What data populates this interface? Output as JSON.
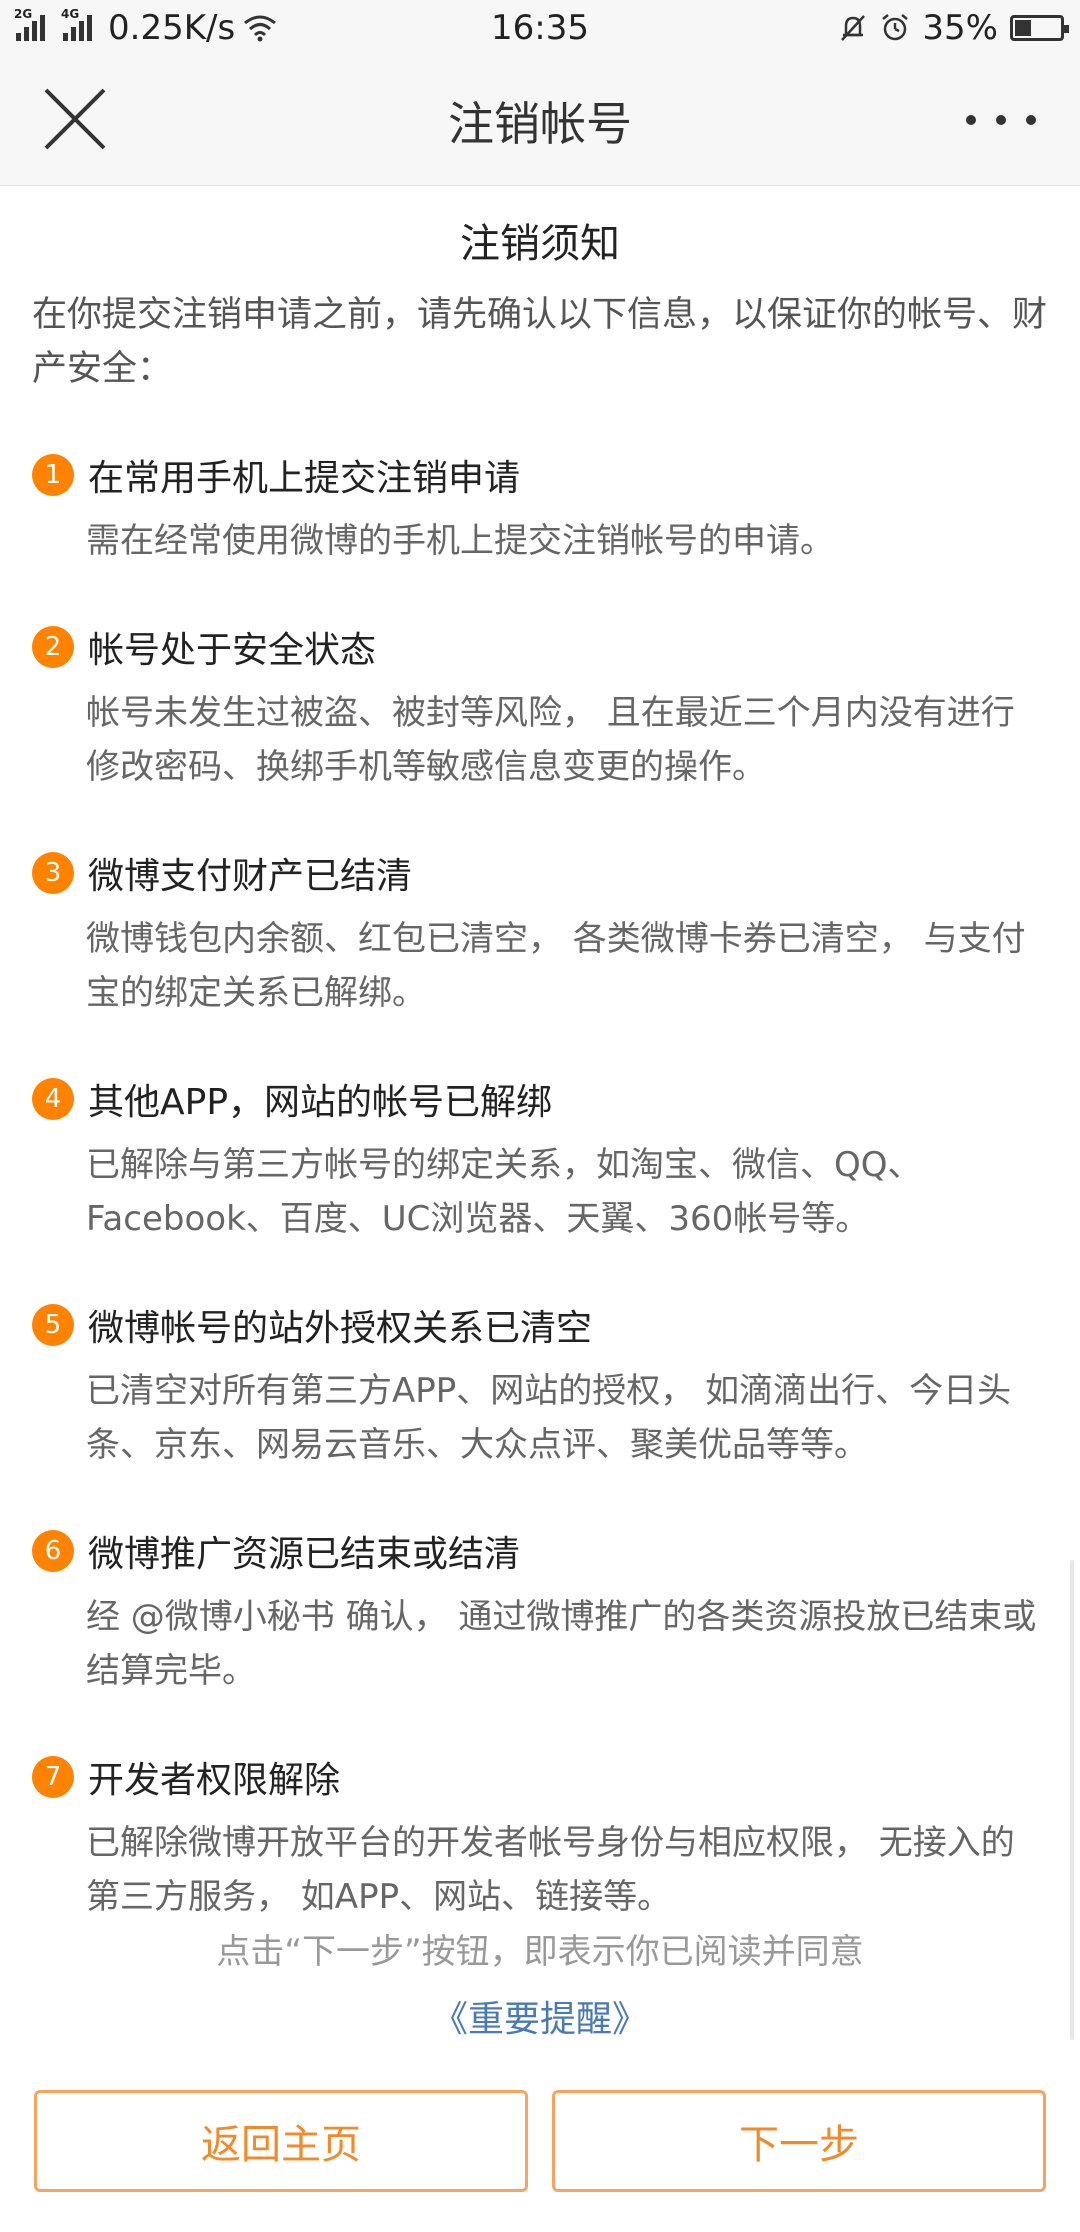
{
  "status": {
    "net_speed": "0.25K/s",
    "sim1": "2G",
    "sim2": "4G",
    "time": "16:35",
    "battery": "35%"
  },
  "header": {
    "title": "注销帐号"
  },
  "notice": {
    "title": "注销须知",
    "intro": "在你提交注销申请之前，请先确认以下信息，以保证你的帐号、财产安全："
  },
  "items": [
    {
      "num": "1",
      "title": "在常用手机上提交注销申请",
      "desc": "需在经常使用微博的手机上提交注销帐号的申请。"
    },
    {
      "num": "2",
      "title": "帐号处于安全状态",
      "desc": "帐号未发生过被盗、被封等风险， 且在最近三个月内没有进行修改密码、换绑手机等敏感信息变更的操作。"
    },
    {
      "num": "3",
      "title": "微博支付财产已结清",
      "desc": "微博钱包内余额、红包已清空， 各类微博卡券已清空， 与支付宝的绑定关系已解绑。"
    },
    {
      "num": "4",
      "title": "其他APP，网站的帐号已解绑",
      "desc": "已解除与第三方帐号的绑定关系，如淘宝、微信、QQ、Facebook、百度、UC浏览器、天翼、360帐号等。"
    },
    {
      "num": "5",
      "title": "微博帐号的站外授权关系已清空",
      "desc": "已清空对所有第三方APP、网站的授权， 如滴滴出行、今日头条、京东、网易云音乐、大众点评、聚美优品等等。"
    },
    {
      "num": "6",
      "title": "微博推广资源已结束或结清",
      "desc": "经 @微博小秘书 确认， 通过微博推广的各类资源投放已结束或结算完毕。"
    },
    {
      "num": "7",
      "title": "开发者权限解除",
      "desc": "已解除微博开放平台的开发者帐号身份与相应权限， 无接入的第三方服务， 如APP、网站、链接等。"
    }
  ],
  "footer": {
    "agree_text": "点击“下一步”按钮，即表示你已阅读并同意",
    "remind_link": "《重要提醒》",
    "home_button": "返回主页",
    "next_button": "下一步"
  },
  "colors": {
    "accent": "#ff8200",
    "link": "#4a7ab5"
  }
}
